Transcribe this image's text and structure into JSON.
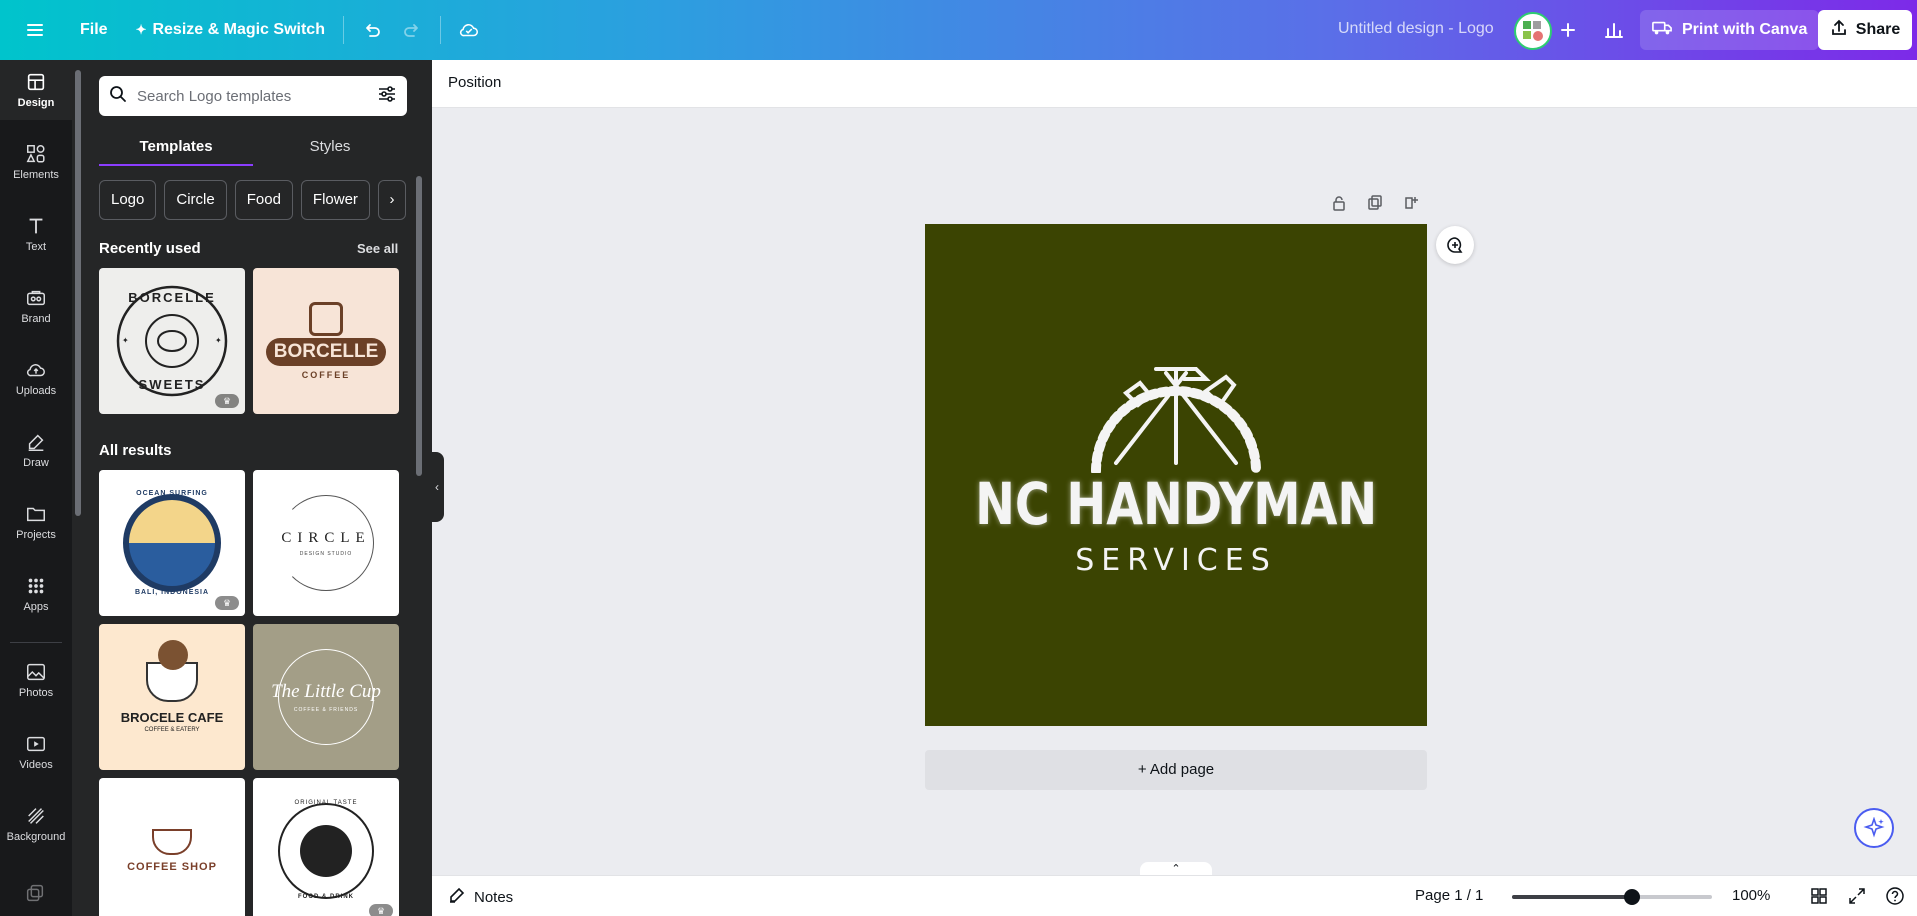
{
  "topbar": {
    "file_label": "File",
    "resize_label": "Resize & Magic Switch",
    "design_title": "Untitled design - Logo",
    "print_label": "Print with Canva",
    "share_label": "Share"
  },
  "rail": {
    "items": [
      {
        "label": "Design"
      },
      {
        "label": "Elements"
      },
      {
        "label": "Text"
      },
      {
        "label": "Brand"
      },
      {
        "label": "Uploads"
      },
      {
        "label": "Draw"
      },
      {
        "label": "Projects"
      },
      {
        "label": "Apps"
      },
      {
        "label": "Photos"
      },
      {
        "label": "Videos"
      },
      {
        "label": "Background"
      }
    ]
  },
  "panel": {
    "search_placeholder": "Search Logo templates",
    "tabs": [
      {
        "label": "Templates"
      },
      {
        "label": "Styles"
      }
    ],
    "chips": [
      "Logo",
      "Circle",
      "Food",
      "Flower"
    ],
    "recently_used_title": "Recently used",
    "see_all": "See all",
    "all_results_title": "All results",
    "recent_templates": [
      {
        "top": "BORCELLE",
        "bottom": "SWEETS"
      },
      {
        "top": "BORCELLE",
        "bottom": "COFFEE"
      }
    ],
    "results": [
      {
        "top": "OCEAN SURFING",
        "bottom": "BALI, INDONESIA"
      },
      {
        "top": "CIRCLE",
        "bottom": "DESIGN STUDIO"
      },
      {
        "top": "BROCELE CAFE",
        "bottom": "COFFEE & EATERY"
      },
      {
        "top": "The Little Cup",
        "bottom": "COFFEE & FRIENDS"
      },
      {
        "top": "COFFEE SHOP",
        "bottom": ""
      },
      {
        "top": "ORIGINAL TASTE",
        "bottom": "FOOD & DRINK"
      }
    ]
  },
  "contextbar": {
    "position_label": "Position"
  },
  "canvas": {
    "background": "#3b4402",
    "headline": "NC HANDYMAN",
    "subline": "SERVICES",
    "add_page_label": "+ Add page"
  },
  "footer": {
    "notes_label": "Notes",
    "page_count": "Page 1 / 1",
    "zoom_value": "100%",
    "zoom_level": 0.6
  },
  "colors": {
    "brand_gradient_start": "#00c4cc",
    "brand_gradient_end": "#7d2ae8",
    "panel_bg": "#252627",
    "rail_bg": "#18191b",
    "tab_accent": "#8b3dff"
  },
  "icons": {
    "menu": "hamburger-icon",
    "undo": "undo-icon",
    "redo": "redo-icon",
    "cloud": "cloud-check-icon",
    "add_collaborator": "plus-icon",
    "analytics": "bar-chart-icon",
    "print": "truck-icon",
    "share": "upload-icon"
  }
}
